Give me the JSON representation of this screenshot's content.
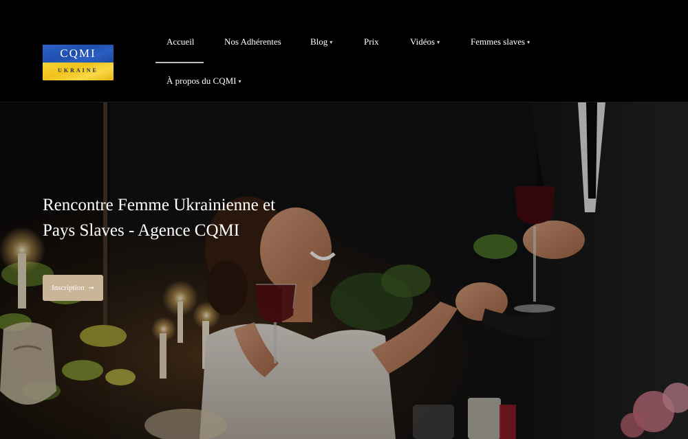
{
  "logo": {
    "title": "CQMI",
    "subtitle": "UKRAINE",
    "colors": {
      "blue": "#2a5ec2",
      "yellow": "#f1c21b"
    }
  },
  "nav": {
    "items": [
      {
        "label": "Accueil",
        "active": true,
        "dropdown": false
      },
      {
        "label": "Nos Adhérentes",
        "active": false,
        "dropdown": false
      },
      {
        "label": "Blog",
        "active": false,
        "dropdown": true
      },
      {
        "label": "Prix",
        "active": false,
        "dropdown": false
      },
      {
        "label": "Vidéos",
        "active": false,
        "dropdown": true
      },
      {
        "label": "Femmes slaves",
        "active": false,
        "dropdown": true
      },
      {
        "label": "À propos du CQMI",
        "active": false,
        "dropdown": true
      }
    ],
    "caret_glyph": "▾"
  },
  "hero": {
    "title_line1": "Rencontre Femme Ukrainienne et",
    "title_line2": "Pays Slaves - Agence CQMI",
    "cta_label": "Inscription",
    "cta_icon": "arrow-right-icon",
    "cta_color": "#c9b597"
  }
}
